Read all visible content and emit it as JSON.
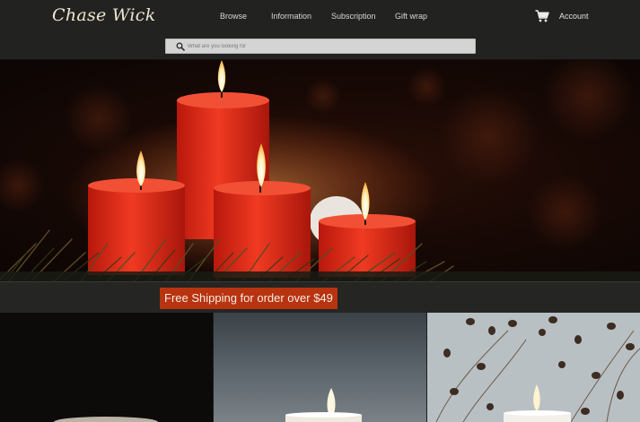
{
  "header": {
    "logo": "Chase Wick",
    "nav": [
      {
        "label": "Browse"
      },
      {
        "label": "Information"
      },
      {
        "label": "Subscription"
      },
      {
        "label": "Gift wrap"
      }
    ],
    "cart_icon": "shopping-cart-icon",
    "account_label": "Account"
  },
  "search": {
    "icon": "search-icon",
    "placeholder": "What are you looking for"
  },
  "hero": {
    "image": "red candles with pine and snow"
  },
  "promo": {
    "text": "Free Shipping for order over $49"
  },
  "products": [
    {
      "image": "candle on dark background"
    },
    {
      "image": "white candle on grey background"
    },
    {
      "image": "candle with dried plant branches"
    }
  ],
  "colors": {
    "header_bg": "#222221",
    "promo_bg": "#b8330f",
    "candle_red": "#e0301a",
    "text_light": "#d8d8d8"
  }
}
